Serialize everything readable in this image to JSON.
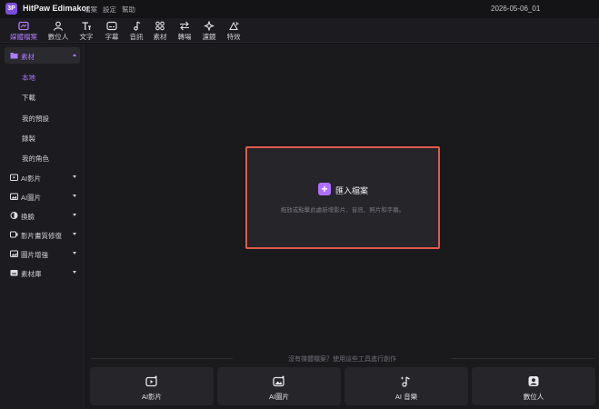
{
  "app": {
    "logo_text": "3P",
    "title": "HitPaw Edimakor",
    "project_name": "2026-05-06_01"
  },
  "menu": [
    "檔案",
    "設定",
    "幫助"
  ],
  "toolbar": [
    {
      "label": "媒體檔案",
      "icon": "media-icon",
      "active": true
    },
    {
      "label": "數位人",
      "icon": "avatar-icon",
      "active": false
    },
    {
      "label": "文字",
      "icon": "text-icon",
      "active": false
    },
    {
      "label": "字幕",
      "icon": "subtitle-icon",
      "active": false
    },
    {
      "label": "音訊",
      "icon": "music-icon",
      "active": false
    },
    {
      "label": "素材",
      "icon": "elements-icon",
      "active": false
    },
    {
      "label": "轉場",
      "icon": "transition-icon",
      "active": false
    },
    {
      "label": "濾鏡",
      "icon": "filter-icon",
      "active": false
    },
    {
      "label": "特效",
      "icon": "effects-icon",
      "active": false
    }
  ],
  "sidebar": {
    "head": {
      "label": "素材",
      "icon": "folder-icon"
    },
    "subitems": [
      {
        "label": "本地",
        "active": true
      },
      {
        "label": "下載",
        "active": false
      },
      {
        "label": "我的預設",
        "active": false
      },
      {
        "label": "錄製",
        "active": false
      },
      {
        "label": "我的角色",
        "active": false
      }
    ],
    "items": [
      {
        "label": "AI影片",
        "icon": "ai-video-icon"
      },
      {
        "label": "AI圖片",
        "icon": "ai-image-icon"
      },
      {
        "label": "換臉",
        "icon": "face-swap-icon"
      },
      {
        "label": "影片畫質修復",
        "icon": "video-enhance-icon"
      },
      {
        "label": "圖片增強",
        "icon": "image-enhance-icon"
      },
      {
        "label": "素材庫",
        "icon": "library-icon"
      }
    ]
  },
  "main": {
    "import_label": "匯入檔案",
    "drop_hint": "拖放或點擊此處新增影片、音訊、照片和字幕。",
    "divider_text": "沒有媒體檔案？使用這些工具進行創作",
    "quick_actions": [
      {
        "label": "AI影片",
        "icon": "ai-video-icon"
      },
      {
        "label": "AI圖片",
        "icon": "ai-image-icon"
      },
      {
        "label": "AI 音樂",
        "icon": "ai-music-icon"
      },
      {
        "label": "數位人",
        "icon": "digital-human-icon"
      }
    ]
  },
  "colors": {
    "accent": "#b07aff",
    "highlight_border": "#e05a4a",
    "background": "#1a1a1d"
  }
}
